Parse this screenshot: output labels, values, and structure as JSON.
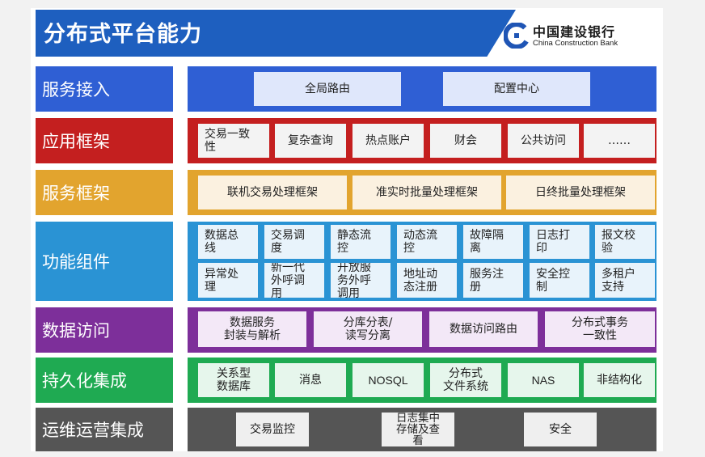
{
  "header": {
    "title": "分布式平台能力",
    "bank_name": "中国建设银行",
    "bank_name_en": "China Construction Bank"
  },
  "colors": {
    "header": "#1e5fbf",
    "service_access": "#2f5fd4",
    "app_framework": "#c41f1f",
    "service_framework": "#e2a42e",
    "function_components": "#2a93d4",
    "data_access": "#7d2f9a",
    "persistence": "#1faa52",
    "ops": "#555555"
  },
  "layers": [
    {
      "label": "服务接入",
      "items": [
        "全局路由",
        "配置中心"
      ]
    },
    {
      "label": "应用框架",
      "items": [
        "交易一致\n性",
        "复杂查询",
        "热点账户",
        "财会",
        "公共访问",
        "……"
      ]
    },
    {
      "label": "服务框架",
      "items": [
        "联机交易处理框架",
        "准实时批量处理框架",
        "日终批量处理框架"
      ]
    },
    {
      "label": "功能组件",
      "items": [
        "数据总\n线",
        "交易调\n度",
        "静态流\n控",
        "动态流\n控",
        "故障隔\n离",
        "日志打\n印",
        "报文校\n验",
        "异常处\n理",
        "新一代\n外呼调\n用",
        "开放服\n务外呼\n调用",
        "地址动\n态注册",
        "服务注\n册",
        "安全控\n制",
        "多租户\n支持"
      ]
    },
    {
      "label": "数据访问",
      "items": [
        "数据服务\n封装与解析",
        "分库分表/\n读写分离",
        "数据访问路由",
        "分布式事务\n一致性"
      ]
    },
    {
      "label": "持久化集成",
      "items": [
        "关系型\n数据库",
        "消息",
        "NOSQL",
        "分布式\n文件系统",
        "NAS",
        "非结构化"
      ]
    },
    {
      "label": "运维运营集成",
      "items": [
        "交易监控",
        "日志集中\n存储及查\n看",
        "安全"
      ]
    }
  ]
}
